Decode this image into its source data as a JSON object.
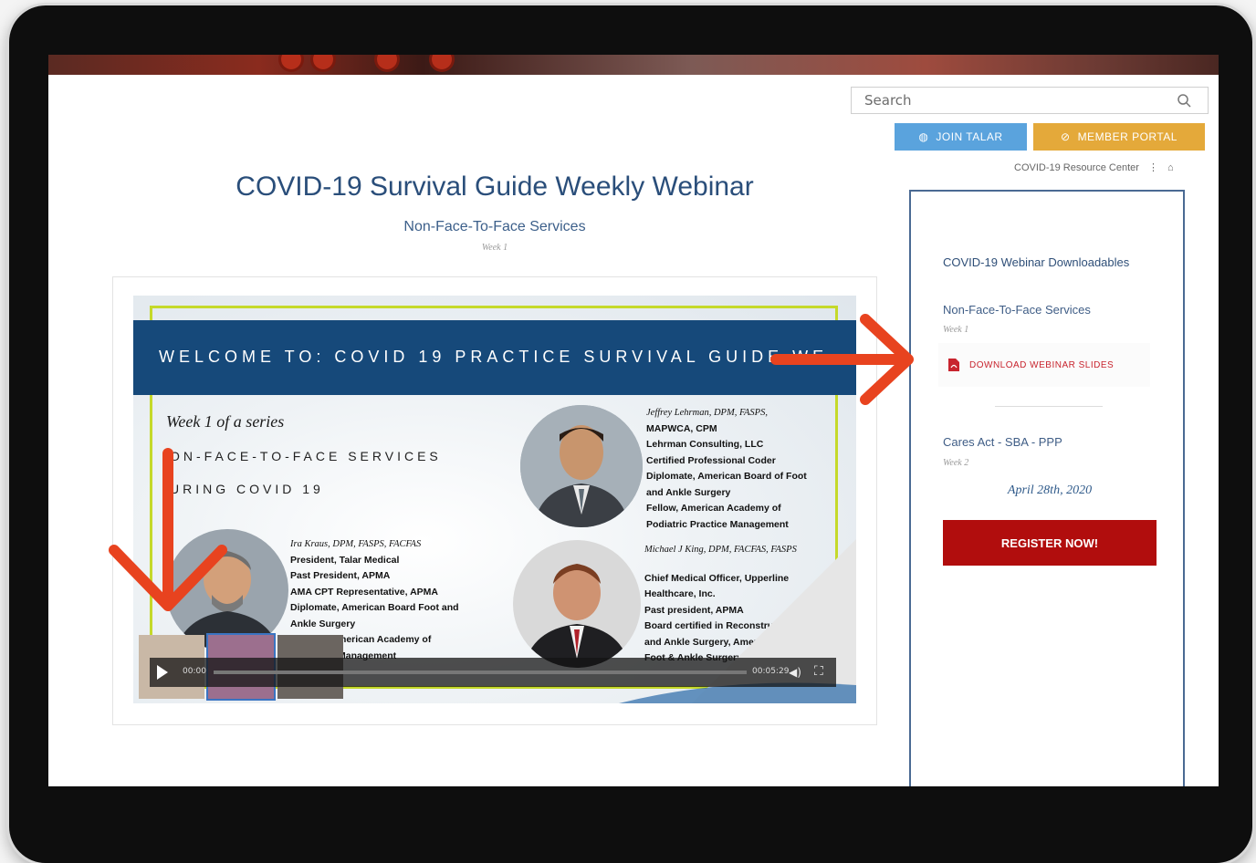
{
  "search": {
    "placeholder": "Search"
  },
  "buttons": {
    "join": "JOIN TALAR",
    "member": "MEMBER PORTAL"
  },
  "breadcrumb": {
    "label": "COVID-19 Resource Center"
  },
  "page": {
    "title": "COVID-19 Survival Guide Weekly Webinar",
    "subtitle": "Non-Face-To-Face Services",
    "week": "Week 1"
  },
  "slide": {
    "banner": "WELCOME TO: COVID 19 PRACTICE SURVIVAL GUIDE WE",
    "series": "Week 1 of a series",
    "line1": "ON-FACE-TO-FACE SERVICES",
    "line2": "URING COVID 19",
    "presenters": [
      {
        "name": "Ira Kraus, DPM, FASPS, FACFAS",
        "lines": [
          "President, Talar Medical",
          "Past President, APMA",
          "AMA CPT Representative, APMA",
          "Diplomate, American Board Foot and",
          "Ankle Surgery",
          "merican Academy of",
          "Management"
        ]
      },
      {
        "name": "Jeffrey Lehrman, DPM, FASPS,",
        "lines": [
          "MAPWCA, CPM",
          "Lehrman Consulting, LLC",
          "Certified Professional Coder",
          "Diplomate, American Board of Foot",
          "and Ankle Surgery",
          "Fellow, American Academy of",
          "Podiatric Practice Management"
        ]
      },
      {
        "name": "Michael J King, DPM, FACFAS, FASPS",
        "lines": [
          "Chief Medical Officer, Upperline",
          "Healthcare, Inc.",
          "Past president, APMA",
          "Board certified in Reconstructive Foot",
          "and Ankle Surgery, American Board of",
          "Foot & Ankle Surgery"
        ]
      }
    ]
  },
  "video": {
    "time_elapsed": "00:00",
    "time_total": "00:05:29"
  },
  "sidebar": {
    "heading": "COVID-19 Webinar Downloadables",
    "item1_title": "Non-Face-To-Face Services",
    "item1_week": "Week 1",
    "download_label": "DOWNLOAD WEBINAR SLIDES",
    "item2_title": "Cares Act - SBA - PPP",
    "item2_week": "Week 2",
    "item2_date": "April 28th, 2020",
    "register_label": "REGISTER NOW!"
  },
  "colors": {
    "accent_blue": "#2a4e7a",
    "join": "#5aa3dd",
    "member": "#e4a93a",
    "register": "#b10d0d",
    "arrow": "#e8431f"
  },
  "icons": [
    "search-icon",
    "globe-icon",
    "link-icon",
    "menu-dots-icon",
    "home-icon",
    "pdf-icon",
    "play-icon",
    "volume-icon",
    "fullscreen-icon"
  ]
}
